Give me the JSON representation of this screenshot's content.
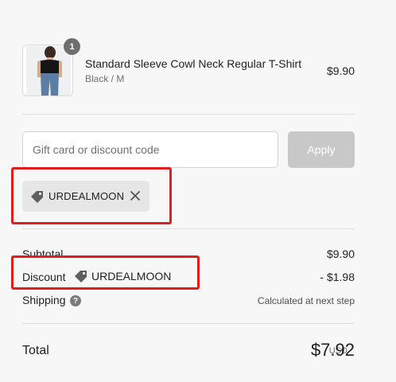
{
  "product": {
    "name": "Standard Sleeve Cowl Neck Regular T-Shirt",
    "variant": "Black / M",
    "price": "$9.90",
    "quantity": "1",
    "image_icon": "product-photo"
  },
  "discount_form": {
    "placeholder": "Gift card or discount code",
    "value": "",
    "apply_label": "Apply"
  },
  "applied_code": {
    "code": "URDEALMOON",
    "tag_icon": "tag-icon",
    "remove_icon": "close-icon"
  },
  "summary": {
    "subtotal_label": "Subtotal",
    "subtotal_value": "$9.90",
    "discount_label": "Discount",
    "discount_code": "URDEALMOON",
    "discount_value": "- $1.98",
    "shipping_label": "Shipping",
    "shipping_help": "?",
    "shipping_value": "Calculated at next step",
    "total_label": "Total",
    "currency": "USD",
    "total_value": "$7.92"
  },
  "colors": {
    "background": "#f7f7f7",
    "highlight_box": "#e11d1d",
    "apply_button": "#c8c8c8",
    "chip_background": "#e6e6e6"
  }
}
